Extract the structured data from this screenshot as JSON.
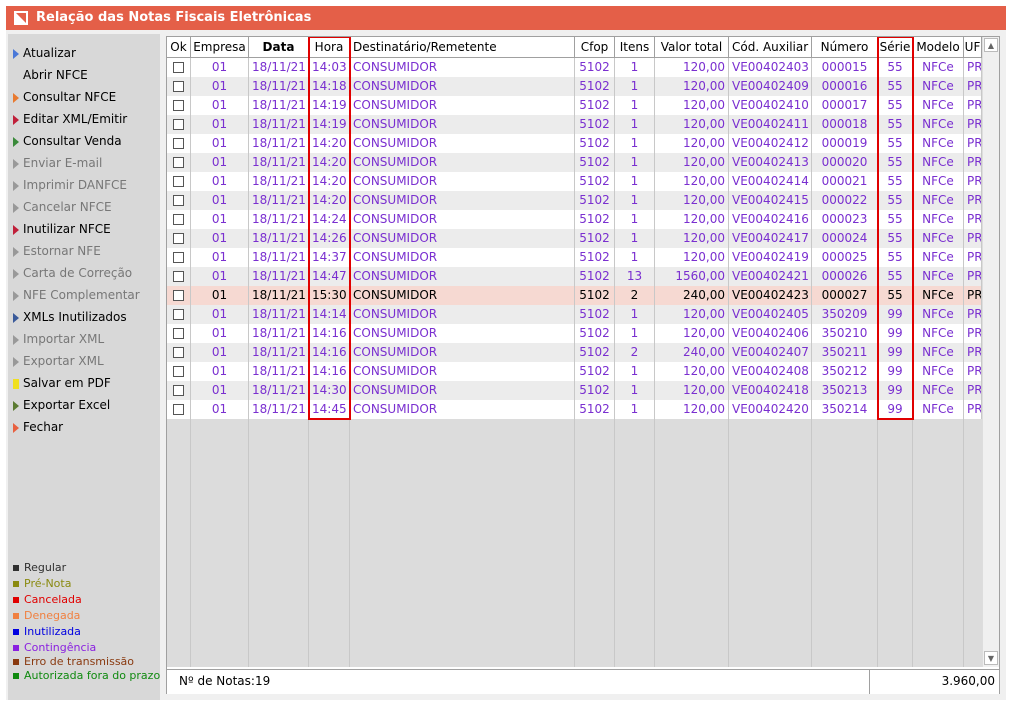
{
  "window": {
    "title": "Relação das Notas Fiscais Eletrônicas",
    "title_bar_color": "#e45f48"
  },
  "sidebar": {
    "items": [
      {
        "label": "Atualizar",
        "accel": "t",
        "arrow": "#4a78d8",
        "disabled": false
      },
      {
        "label": "Abrir NFCE",
        "accel": "A",
        "arrow": null,
        "disabled": false
      },
      {
        "label": "Consultar NFCE",
        "accel": "C",
        "arrow": "#e87a30",
        "disabled": false
      },
      {
        "label": "Editar XML/Emitir",
        "accel": "E",
        "arrow": "#c0203a",
        "disabled": false
      },
      {
        "label": "Consultar Venda",
        "accel": "V",
        "arrow": "#3a8a3a",
        "disabled": false
      },
      {
        "label": "Enviar E-mail",
        "accel": "",
        "arrow": "#999999",
        "disabled": true
      },
      {
        "label": "Imprimir DANFCE",
        "accel": "I",
        "arrow": "#999999",
        "disabled": true
      },
      {
        "label": "Cancelar NFCE",
        "accel": "C",
        "arrow": "#999999",
        "disabled": true
      },
      {
        "label": "Inutilizar NFCE",
        "accel": "I",
        "arrow": "#c0203a",
        "disabled": false
      },
      {
        "label": "Estornar NFE",
        "accel": "",
        "arrow": "#999999",
        "disabled": true
      },
      {
        "label": "Carta de Correção",
        "accel": "",
        "arrow": "#999999",
        "disabled": true
      },
      {
        "label": "NFE Complementar",
        "accel": "",
        "arrow": "#999999",
        "disabled": true
      },
      {
        "label": "XMLs Inutilizados",
        "accel": "",
        "arrow": "#3a5a9a",
        "disabled": false
      },
      {
        "label": "Importar XML",
        "accel": "",
        "arrow": "#999999",
        "disabled": true
      },
      {
        "label": "Exportar XML",
        "accel": "",
        "arrow": "#999999",
        "disabled": true
      },
      {
        "label": "Salvar em PDF",
        "accel": "P",
        "square": "#f0e020",
        "disabled": false
      },
      {
        "label": "Exportar Excel",
        "accel": "x",
        "arrow": "#5a7a30",
        "disabled": false
      },
      {
        "label": "Fechar",
        "accel": "",
        "arrow": "#e86040",
        "disabled": false
      }
    ],
    "legend": [
      {
        "label": "Regular",
        "color": "#303030"
      },
      {
        "label": "Pré-Nota",
        "color": "#8a8a10"
      },
      {
        "label": "Cancelada",
        "color": "#e00000"
      },
      {
        "label": "Denegada",
        "color": "#f08040"
      },
      {
        "label": "Inutilizada",
        "color": "#0000e0"
      },
      {
        "label": "Contingência",
        "color": "#8a20e0"
      },
      {
        "label": "Erro de transmissão",
        "color": "#8a3a10"
      },
      {
        "label": "Autorizada fora do prazo",
        "color": "#108a10"
      }
    ]
  },
  "table": {
    "columns": [
      "Ok",
      "Empresa",
      "Data",
      "Hora",
      "Destinatário/Remetente",
      "Cfop",
      "Itens",
      "Valor total",
      "Cód. Auxiliar",
      "Número",
      "Série",
      "Modelo",
      "UF"
    ],
    "rows": [
      [
        "01",
        "18/11/21",
        "14:03",
        "CONSUMIDOR",
        "5102",
        "1",
        "120,00",
        "VE00402403",
        "000015",
        "55",
        "NFCe",
        "PR"
      ],
      [
        "01",
        "18/11/21",
        "14:18",
        "CONSUMIDOR",
        "5102",
        "1",
        "120,00",
        "VE00402409",
        "000016",
        "55",
        "NFCe",
        "PR"
      ],
      [
        "01",
        "18/11/21",
        "14:19",
        "CONSUMIDOR",
        "5102",
        "1",
        "120,00",
        "VE00402410",
        "000017",
        "55",
        "NFCe",
        "PR"
      ],
      [
        "01",
        "18/11/21",
        "14:19",
        "CONSUMIDOR",
        "5102",
        "1",
        "120,00",
        "VE00402411",
        "000018",
        "55",
        "NFCe",
        "PR"
      ],
      [
        "01",
        "18/11/21",
        "14:20",
        "CONSUMIDOR",
        "5102",
        "1",
        "120,00",
        "VE00402412",
        "000019",
        "55",
        "NFCe",
        "PR"
      ],
      [
        "01",
        "18/11/21",
        "14:20",
        "CONSUMIDOR",
        "5102",
        "1",
        "120,00",
        "VE00402413",
        "000020",
        "55",
        "NFCe",
        "PR"
      ],
      [
        "01",
        "18/11/21",
        "14:20",
        "CONSUMIDOR",
        "5102",
        "1",
        "120,00",
        "VE00402414",
        "000021",
        "55",
        "NFCe",
        "PR"
      ],
      [
        "01",
        "18/11/21",
        "14:20",
        "CONSUMIDOR",
        "5102",
        "1",
        "120,00",
        "VE00402415",
        "000022",
        "55",
        "NFCe",
        "PR"
      ],
      [
        "01",
        "18/11/21",
        "14:24",
        "CONSUMIDOR",
        "5102",
        "1",
        "120,00",
        "VE00402416",
        "000023",
        "55",
        "NFCe",
        "PR"
      ],
      [
        "01",
        "18/11/21",
        "14:26",
        "CONSUMIDOR",
        "5102",
        "1",
        "120,00",
        "VE00402417",
        "000024",
        "55",
        "NFCe",
        "PR"
      ],
      [
        "01",
        "18/11/21",
        "14:37",
        "CONSUMIDOR",
        "5102",
        "1",
        "120,00",
        "VE00402419",
        "000025",
        "55",
        "NFCe",
        "PR"
      ],
      [
        "01",
        "18/11/21",
        "14:47",
        "CONSUMIDOR",
        "5102",
        "13",
        "1560,00",
        "VE00402421",
        "000026",
        "55",
        "NFCe",
        "PR"
      ],
      [
        "01",
        "18/11/21",
        "15:30",
        "CONSUMIDOR",
        "5102",
        "2",
        "240,00",
        "VE00402423",
        "000027",
        "55",
        "NFCe",
        "PR"
      ],
      [
        "01",
        "18/11/21",
        "14:14",
        "CONSUMIDOR",
        "5102",
        "1",
        "120,00",
        "VE00402405",
        "350209",
        "99",
        "NFCe",
        "PR"
      ],
      [
        "01",
        "18/11/21",
        "14:16",
        "CONSUMIDOR",
        "5102",
        "1",
        "120,00",
        "VE00402406",
        "350210",
        "99",
        "NFCe",
        "PR"
      ],
      [
        "01",
        "18/11/21",
        "14:16",
        "CONSUMIDOR",
        "5102",
        "2",
        "240,00",
        "VE00402407",
        "350211",
        "99",
        "NFCe",
        "PR"
      ],
      [
        "01",
        "18/11/21",
        "14:16",
        "CONSUMIDOR",
        "5102",
        "1",
        "120,00",
        "VE00402408",
        "350212",
        "99",
        "NFCe",
        "PR"
      ],
      [
        "01",
        "18/11/21",
        "14:30",
        "CONSUMIDOR",
        "5102",
        "1",
        "120,00",
        "VE00402418",
        "350213",
        "99",
        "NFCe",
        "PR"
      ],
      [
        "01",
        "18/11/21",
        "14:45",
        "CONSUMIDOR",
        "5102",
        "1",
        "120,00",
        "VE00402420",
        "350214",
        "99",
        "NFCe",
        "PR"
      ]
    ],
    "selected_row_index": 12,
    "row_text_color": "#7a2fd0",
    "selected_row_color": "#f6d9d2"
  },
  "footer": {
    "count_label": "Nº de Notas:",
    "count_value": "19",
    "total": "3.960,00"
  }
}
